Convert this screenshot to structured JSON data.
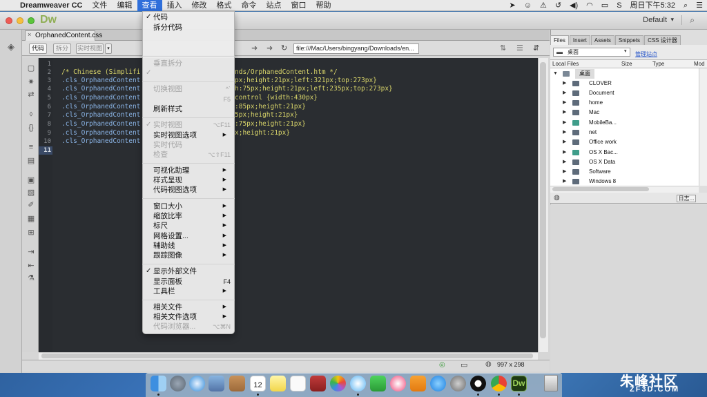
{
  "menubar": {
    "apple": "",
    "app_name": "Dreamweaver CC",
    "items": [
      "文件",
      "编辑",
      "查看",
      "插入",
      "修改",
      "格式",
      "命令",
      "站点",
      "窗口",
      "帮助"
    ],
    "active": "查看",
    "clock": "周日下午5:32"
  },
  "app": {
    "logo": "Dw",
    "workspace": "Default",
    "workspace_arrow": "▾",
    "search_icon": "search-icon"
  },
  "document": {
    "tab_name": "OrphanedContent.css",
    "tab_close": "×",
    "toolbar": {
      "code": "代码",
      "split": "拆分",
      "live": "实时视图",
      "dropdown": "▾",
      "address": "file:///Mac/Users/bingyang/Downloads/en..."
    },
    "line_numbers": [
      "1",
      "2",
      "3",
      "4",
      "5",
      "6",
      "7",
      "8",
      "9",
      "10",
      "11"
    ],
    "code_lines": [
      {
        "n": "1",
        "text": ""
      },
      {
        "n": "2",
        "left": "/* Chinese (Simplifi",
        "right": "nds/OrphanedContent.htm */"
      },
      {
        "n": "3",
        "left": ".cls_OrphanedContent",
        "right": "px;height:21px;left:321px;top:273px}"
      },
      {
        "n": "4",
        "left": ".cls_OrphanedContent",
        "right": "h:75px;height:21px;left:235px;top:273px}"
      },
      {
        "n": "5",
        "left": ".cls_OrphanedContent",
        "right": "control {width:430px}"
      },
      {
        "n": "6",
        "left": ".cls_OrphanedContent",
        "right": ":85px;height:21px}"
      },
      {
        "n": "7",
        "left": ".cls_OrphanedContent",
        "right": "5px;height:21px}"
      },
      {
        "n": "8",
        "left": ".cls_OrphanedContent",
        "right": ":75px;height:21px}"
      },
      {
        "n": "9",
        "left": ".cls_OrphanedContent",
        "right": "x;height:21px}"
      },
      {
        "n": "10",
        "left": ".cls_OrphanedContent",
        "right": ""
      },
      {
        "n": "11",
        "text": ""
      }
    ],
    "status": {
      "dimensions": "997 x 298"
    }
  },
  "view_menu": {
    "items": [
      {
        "label": "代码",
        "checked": true
      },
      {
        "label": "拆分代码"
      },
      {
        "label": "垂直拆分",
        "disabled": true
      },
      {
        "label": "",
        "checked": true,
        "disabled": true
      },
      {
        "label": "切换视图",
        "disabled": true,
        "shortcut": "^`"
      },
      {
        "label": "",
        "shortcut": "F5",
        "disabled": true
      },
      {
        "label": "刷新样式"
      },
      {
        "label": "实时视图",
        "checked": true,
        "disabled": true,
        "shortcut": "⌥F11"
      },
      {
        "label": "实时视图选项",
        "submenu": true
      },
      {
        "label": "实时代码",
        "disabled": true
      },
      {
        "label": "检查",
        "disabled": true,
        "shortcut": "⌥⇧F11"
      },
      {
        "label": "可视化助理",
        "submenu": true
      },
      {
        "label": "样式呈现",
        "submenu": true
      },
      {
        "label": "代码视图选项",
        "submenu": true
      },
      {
        "label": "窗口大小",
        "submenu": true
      },
      {
        "label": "缩放比率",
        "submenu": true
      },
      {
        "label": "标尺",
        "submenu": true
      },
      {
        "label": "网格设置...",
        "submenu": true
      },
      {
        "label": "辅助线",
        "submenu": true
      },
      {
        "label": "跟踪图像",
        "submenu": true
      },
      {
        "label": "显示外部文件",
        "checked": true
      },
      {
        "label": "显示面板",
        "shortcut": "F4"
      },
      {
        "label": "工具栏",
        "submenu": true
      },
      {
        "label": "相关文件",
        "submenu": true
      },
      {
        "label": "相关文件选项",
        "submenu": true
      },
      {
        "label": "代码浏览器...",
        "disabled": true,
        "shortcut": "⌥⌘N"
      }
    ]
  },
  "files_panel": {
    "tabs": [
      "Files",
      "Insert",
      "Assets",
      "Snippets",
      "CSS 设计器"
    ],
    "active_tab": "Files",
    "site": "桌面",
    "manage": "管理站点",
    "columns": [
      "Local Files",
      "Size",
      "Type",
      "Mod"
    ],
    "root": "桌面",
    "entries": [
      "CLOVER",
      "Document",
      "home",
      "Mac",
      "MobileBa...",
      "net",
      "Office work",
      "OS X Bac...",
      "OS X Data",
      "Software",
      "Windows 8"
    ],
    "log_button": "日志..."
  },
  "dock": {
    "apps": [
      "finder-icon",
      "launchpad-icon",
      "safari-icon",
      "preview-icon",
      "contacts-icon",
      "calendar-icon",
      "notes-icon",
      "reminders-icon",
      "photo-booth-icon",
      "photos-icon",
      "messages-icon",
      "facetime-icon",
      "itunes-icon",
      "ibooks-icon",
      "app-store-icon",
      "system-preferences-icon",
      "qq-icon",
      "chrome-icon",
      "dreamweaver-icon"
    ],
    "calendar_day": "12",
    "trash": "trash-icon"
  },
  "watermark": {
    "line1": "朱峰社区",
    "line2": "ZF3D.COM"
  },
  "colors": {
    "accent": "#2f6fdb",
    "code_bg": "#2a2d31",
    "comment": "#d9d56a",
    "selector": "#8ab4e6",
    "dw_green": "#8fae55"
  }
}
